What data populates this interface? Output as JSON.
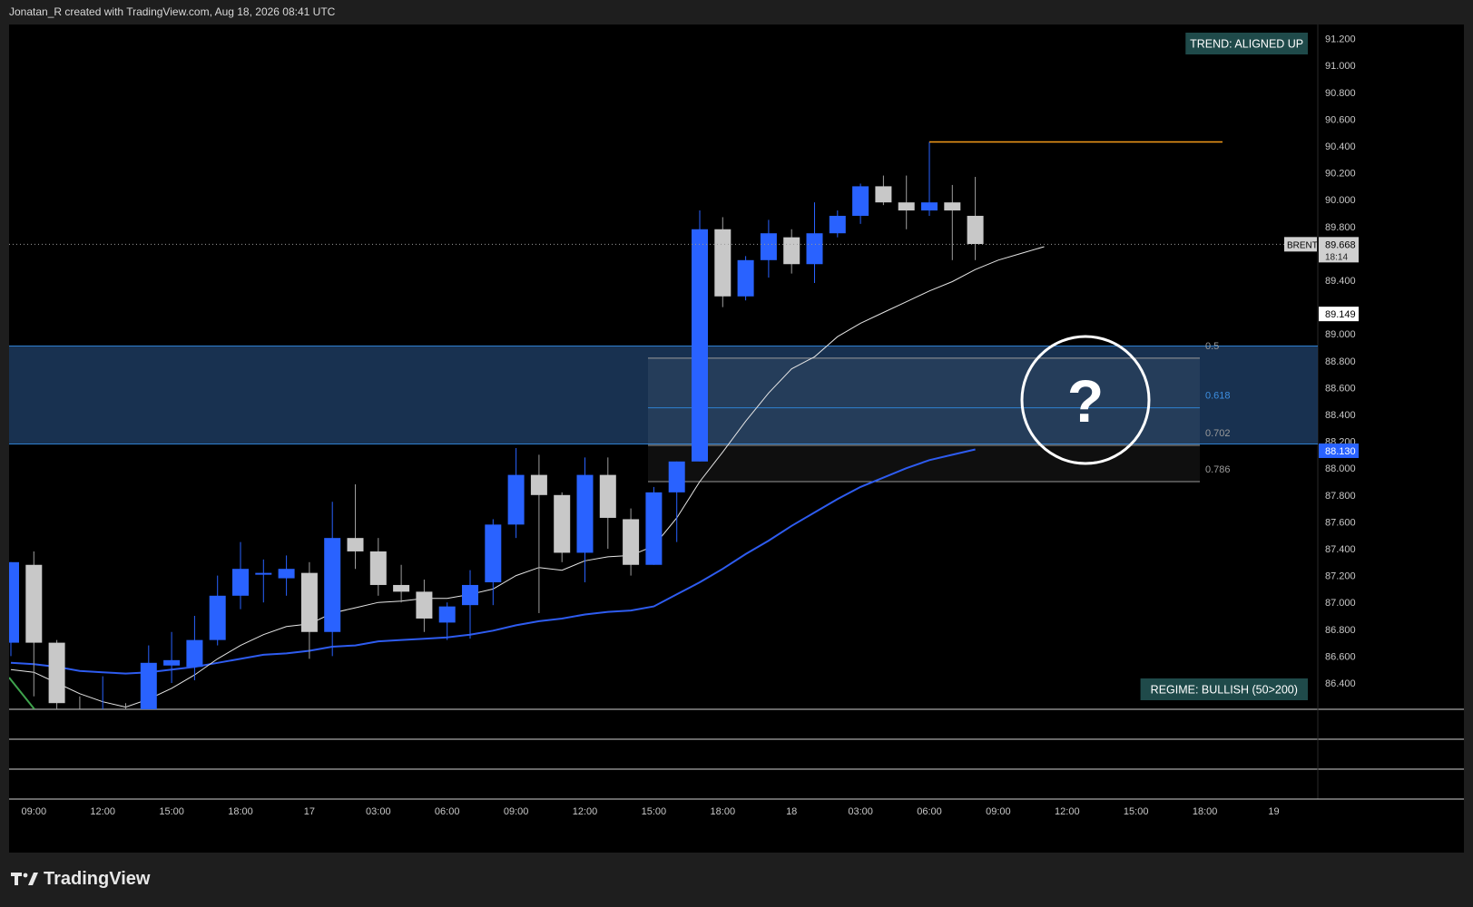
{
  "header": {
    "text": "Jonatan_R created with TradingView.com, Aug 18, 2026 08:41 UTC"
  },
  "footer": {
    "brand": "TradingView",
    "logo_icon": "tradingview-logo-icon"
  },
  "colors": {
    "up": "#2962ff",
    "down": "#c8c8c8",
    "ma_fast": "#e6e6e6",
    "ma_slow": "#2e5cf0",
    "fib_zone": "#1c3a5e",
    "high_line": "#f59c1a",
    "badge_bg": "#1f4a4a"
  },
  "badges": {
    "trend": "TREND: ALIGNED UP",
    "regime": "REGIME: BULLISH (50>200)"
  },
  "annotation": {
    "symbol": "?",
    "icon": "question-mark-circle-icon"
  },
  "chart_data": {
    "type": "candlestick",
    "symbol": "BRENT",
    "last_price": "89.668",
    "countdown": "18:14",
    "ma_fast_label": "89.149",
    "ma_slow_label": "88.130",
    "ylim": [
      86.2,
      91.3
    ],
    "price_ticks": [
      "91.200",
      "91.000",
      "90.800",
      "90.600",
      "90.400",
      "90.200",
      "90.000",
      "89.800",
      "89.400",
      "89.000",
      "88.800",
      "88.600",
      "88.400",
      "88.200",
      "88.000",
      "87.800",
      "87.600",
      "87.400",
      "87.200",
      "87.000",
      "86.800",
      "86.600",
      "86.400"
    ],
    "time_ticks": [
      {
        "label": "09:00",
        "bar": 1
      },
      {
        "label": "12:00",
        "bar": 4
      },
      {
        "label": "15:00",
        "bar": 7
      },
      {
        "label": "18:00",
        "bar": 10
      },
      {
        "label": "17",
        "bar": 13
      },
      {
        "label": "03:00",
        "bar": 16
      },
      {
        "label": "06:00",
        "bar": 19
      },
      {
        "label": "09:00",
        "bar": 22
      },
      {
        "label": "12:00",
        "bar": 25
      },
      {
        "label": "15:00",
        "bar": 28
      },
      {
        "label": "18:00",
        "bar": 31
      },
      {
        "label": "18",
        "bar": 34
      },
      {
        "label": "03:00",
        "bar": 37
      },
      {
        "label": "06:00",
        "bar": 40
      },
      {
        "label": "09:00",
        "bar": 43
      },
      {
        "label": "12:00",
        "bar": 46
      },
      {
        "label": "15:00",
        "bar": 49
      },
      {
        "label": "18:00",
        "bar": 52
      },
      {
        "label": "19",
        "bar": 55
      }
    ],
    "candles": [
      {
        "o": 86.7,
        "h": 87.3,
        "l": 86.6,
        "c": 87.3
      },
      {
        "o": 87.28,
        "h": 87.38,
        "l": 86.3,
        "c": 86.7
      },
      {
        "o": 86.7,
        "h": 86.72,
        "l": 86.1,
        "c": 86.25
      },
      {
        "o": 86.2,
        "h": 86.3,
        "l": 86.05,
        "c": 86.15
      },
      {
        "o": 86.15,
        "h": 86.45,
        "l": 86.05,
        "c": 86.2
      },
      {
        "o": 86.2,
        "h": 86.25,
        "l": 86.0,
        "c": 86.05
      },
      {
        "o": 86.1,
        "h": 86.68,
        "l": 86.1,
        "c": 86.55
      },
      {
        "o": 86.53,
        "h": 86.78,
        "l": 86.4,
        "c": 86.57
      },
      {
        "o": 86.52,
        "h": 86.9,
        "l": 86.42,
        "c": 86.72
      },
      {
        "o": 86.72,
        "h": 87.2,
        "l": 86.68,
        "c": 87.05
      },
      {
        "o": 87.05,
        "h": 87.45,
        "l": 86.95,
        "c": 87.25
      },
      {
        "o": 87.22,
        "h": 87.32,
        "l": 87.0,
        "c": 87.22
      },
      {
        "o": 87.18,
        "h": 87.35,
        "l": 87.05,
        "c": 87.25
      },
      {
        "o": 87.22,
        "h": 87.3,
        "l": 86.58,
        "c": 86.78
      },
      {
        "o": 86.78,
        "h": 87.75,
        "l": 86.6,
        "c": 87.48
      },
      {
        "o": 87.48,
        "h": 87.88,
        "l": 87.25,
        "c": 87.38
      },
      {
        "o": 87.38,
        "h": 87.48,
        "l": 87.05,
        "c": 87.13
      },
      {
        "o": 87.13,
        "h": 87.28,
        "l": 87.0,
        "c": 87.08
      },
      {
        "o": 87.08,
        "h": 87.17,
        "l": 86.78,
        "c": 86.88
      },
      {
        "o": 86.85,
        "h": 87.0,
        "l": 86.72,
        "c": 86.97
      },
      {
        "o": 86.98,
        "h": 87.24,
        "l": 86.73,
        "c": 87.13
      },
      {
        "o": 87.15,
        "h": 87.62,
        "l": 86.98,
        "c": 87.58
      },
      {
        "o": 87.58,
        "h": 88.15,
        "l": 87.48,
        "c": 87.95
      },
      {
        "o": 87.95,
        "h": 88.1,
        "l": 86.92,
        "c": 87.8
      },
      {
        "o": 87.8,
        "h": 87.82,
        "l": 87.3,
        "c": 87.37
      },
      {
        "o": 87.37,
        "h": 88.08,
        "l": 87.15,
        "c": 87.95
      },
      {
        "o": 87.95,
        "h": 88.08,
        "l": 87.4,
        "c": 87.63
      },
      {
        "o": 87.62,
        "h": 87.7,
        "l": 87.2,
        "c": 87.28
      },
      {
        "o": 87.28,
        "h": 87.86,
        "l": 87.28,
        "c": 87.82
      },
      {
        "o": 87.82,
        "h": 88.05,
        "l": 87.45,
        "c": 88.05
      },
      {
        "o": 88.05,
        "h": 89.92,
        "l": 88.05,
        "c": 89.78
      },
      {
        "o": 89.78,
        "h": 89.87,
        "l": 89.2,
        "c": 89.28
      },
      {
        "o": 89.28,
        "h": 89.58,
        "l": 89.25,
        "c": 89.55
      },
      {
        "o": 89.55,
        "h": 89.85,
        "l": 89.42,
        "c": 89.75
      },
      {
        "o": 89.72,
        "h": 89.78,
        "l": 89.45,
        "c": 89.52
      },
      {
        "o": 89.52,
        "h": 89.98,
        "l": 89.38,
        "c": 89.75
      },
      {
        "o": 89.75,
        "h": 89.92,
        "l": 89.72,
        "c": 89.88
      },
      {
        "o": 89.88,
        "h": 90.12,
        "l": 89.82,
        "c": 90.1
      },
      {
        "o": 90.1,
        "h": 90.18,
        "l": 89.96,
        "c": 89.98
      },
      {
        "o": 89.98,
        "h": 90.18,
        "l": 89.78,
        "c": 89.92
      },
      {
        "o": 89.92,
        "h": 90.43,
        "l": 89.88,
        "c": 89.98
      },
      {
        "o": 89.98,
        "h": 90.11,
        "l": 89.55,
        "c": 89.92
      },
      {
        "o": 89.88,
        "h": 90.17,
        "l": 89.55,
        "c": 89.67
      }
    ],
    "ma_fast": [
      86.5,
      86.48,
      86.4,
      86.32,
      86.26,
      86.22,
      86.28,
      86.36,
      86.46,
      86.58,
      86.68,
      86.76,
      86.82,
      86.84,
      86.92,
      86.96,
      87.0,
      87.01,
      87.03,
      87.03,
      87.06,
      87.1,
      87.2,
      87.26,
      87.24,
      87.31,
      87.34,
      87.35,
      87.42,
      87.63,
      87.9,
      88.12,
      88.35,
      88.56,
      88.74,
      88.83,
      88.98,
      89.08,
      89.16,
      89.24,
      89.32,
      89.39,
      89.48,
      89.55,
      89.6,
      89.65
    ],
    "ma_slow": [
      86.55,
      86.54,
      86.52,
      86.49,
      86.48,
      86.47,
      86.48,
      86.5,
      86.52,
      86.55,
      86.58,
      86.61,
      86.62,
      86.64,
      86.67,
      86.68,
      86.71,
      86.72,
      86.73,
      86.74,
      86.76,
      86.79,
      86.83,
      86.86,
      86.88,
      86.91,
      86.93,
      86.94,
      86.97,
      87.06,
      87.15,
      87.25,
      87.36,
      87.46,
      87.57,
      87.67,
      87.77,
      87.86,
      87.93,
      88.0,
      88.06,
      88.1,
      88.14
    ],
    "fib_levels": [
      {
        "ratio": "0.5",
        "price": 88.82
      },
      {
        "ratio": "0.618",
        "price": 88.45
      },
      {
        "ratio": "0.702",
        "price": 88.17
      },
      {
        "ratio": "0.786",
        "price": 87.9
      }
    ],
    "zone": {
      "top": 88.91,
      "bottom": 88.18
    },
    "recent_high": 90.43
  }
}
